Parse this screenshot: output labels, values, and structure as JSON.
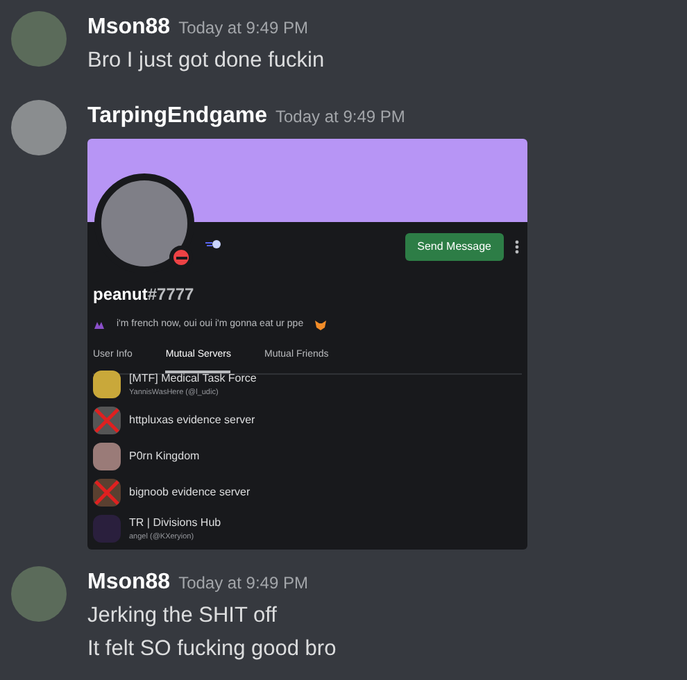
{
  "messages": [
    {
      "author": "Mson88",
      "time": "Today at 9:49 PM",
      "lines": [
        "Bro I just got done fuckin"
      ]
    },
    {
      "author": "TarpingEndgame",
      "time": "Today at 9:49 PM",
      "attachment": {
        "kind": "profile",
        "username": "peanut",
        "tag": "#7777",
        "do_not_disturb": true,
        "bio": "i'm french now, oui oui i'm gonna eat ur ppe",
        "button": "Send Message",
        "tabs": [
          {
            "label": "User Info",
            "selected": false
          },
          {
            "label": "Mutual Servers",
            "selected": true
          },
          {
            "label": "Mutual Friends",
            "selected": false
          }
        ],
        "servers": [
          {
            "name": "[MTF] Medical Task Force",
            "owner": "YannisWasHere (@l_udic)",
            "crossed": false,
            "color": "#c9a83a"
          },
          {
            "name": "httpluxas evidence server",
            "crossed": true,
            "color": "#555555"
          },
          {
            "name": "P0rn Kingdom",
            "crossed": false,
            "color": "#9a7b78"
          },
          {
            "name": "bignoob evidence server",
            "crossed": true,
            "color": "#5a4030"
          },
          {
            "name": "TR | Divisions Hub",
            "owner": "angel (@KXeryion)",
            "crossed": false,
            "color": "#2a1f3d"
          }
        ]
      }
    },
    {
      "author": "Mson88",
      "time": "Today at 9:49 PM",
      "lines": [
        "Jerking the SHIT off",
        "It felt SO fucking good bro"
      ]
    }
  ]
}
